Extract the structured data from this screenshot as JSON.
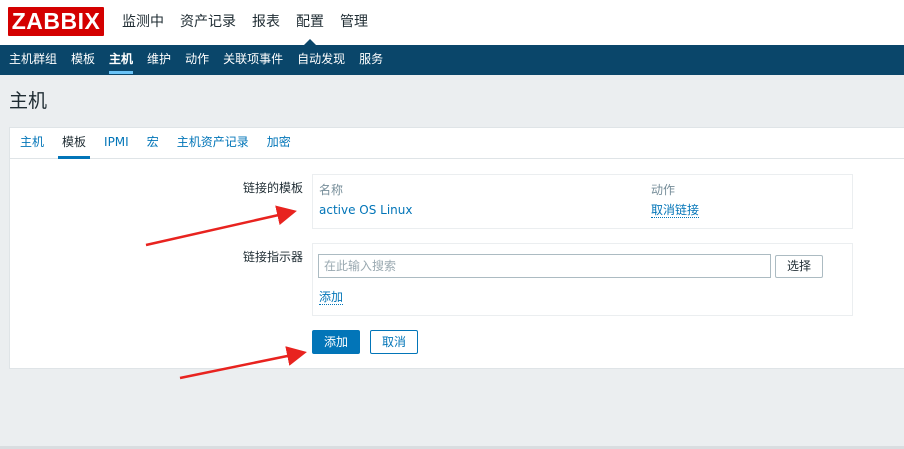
{
  "header": {
    "logo": "ZABBIX",
    "menu": [
      "监测中",
      "资产记录",
      "报表",
      "配置",
      "管理"
    ],
    "active_menu_index": 3
  },
  "subnav": {
    "items": [
      "主机群组",
      "模板",
      "主机",
      "维护",
      "动作",
      "关联项事件",
      "自动发现",
      "服务"
    ],
    "active_index": 2
  },
  "page": {
    "title": "主机"
  },
  "tabs": {
    "items": [
      "主机",
      "模板",
      "IPMI",
      "宏",
      "主机资产记录",
      "加密"
    ],
    "active_index": 1
  },
  "linked_templates": {
    "label": "链接的模板",
    "col_name": "名称",
    "col_action": "动作",
    "rows": [
      {
        "name": "active OS Linux",
        "action": "取消链接"
      }
    ]
  },
  "link_new": {
    "label": "链接指示器",
    "placeholder": "在此输入搜索",
    "select_label": "选择",
    "add_link_label": "添加"
  },
  "form_buttons": {
    "add": "添加",
    "cancel": "取消"
  },
  "colors": {
    "logo_red": "#d40000",
    "nav_blue": "#0a466a",
    "link_blue": "#0275b8",
    "annotation_arrow": "#e8231f"
  }
}
